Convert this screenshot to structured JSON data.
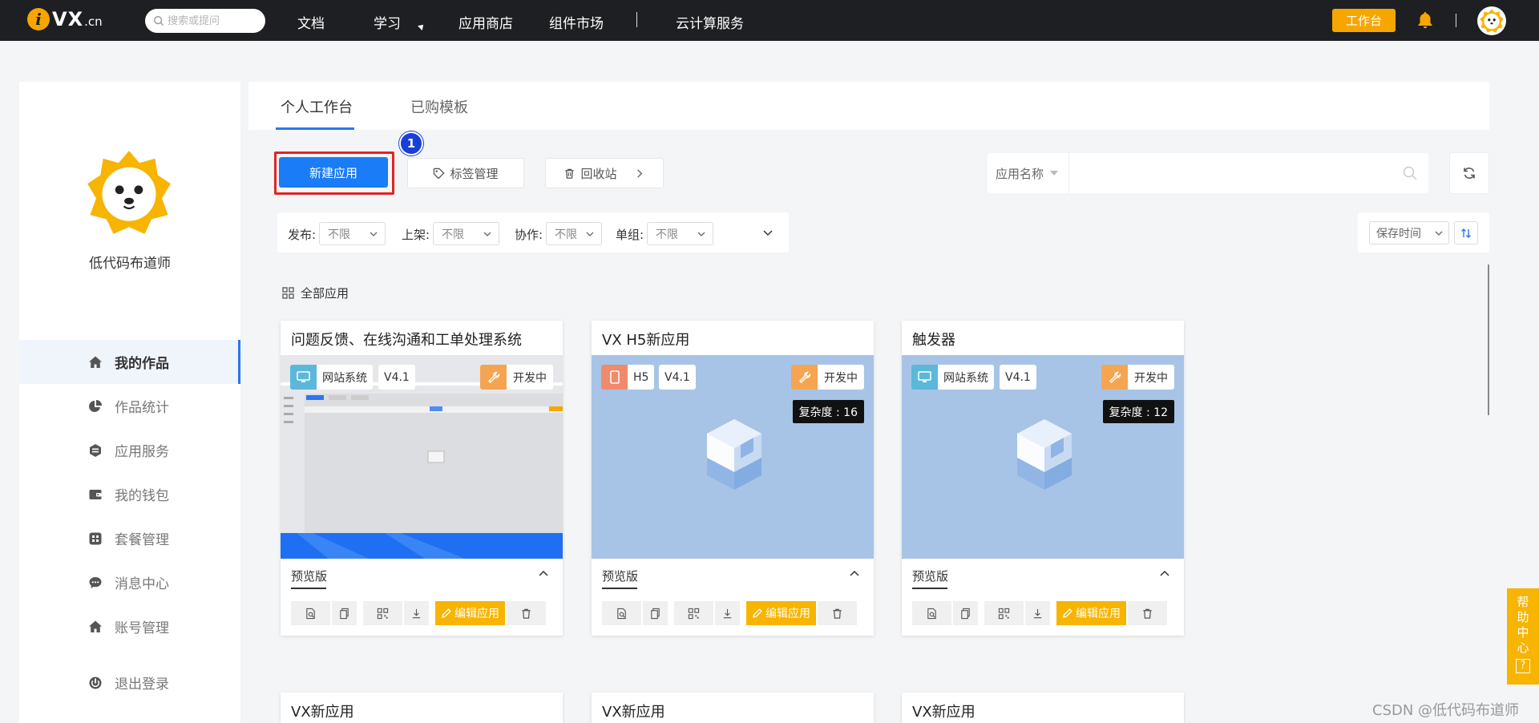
{
  "topbar": {
    "logo_text": "VX",
    "logo_suffix": ".cn",
    "search_placeholder": "搜索或提问",
    "nav": [
      "文档",
      "学习",
      "应用商店",
      "组件市场",
      "云计算服务"
    ],
    "workbench_label": "工作台"
  },
  "sidebar": {
    "username": "低代码布道师",
    "menu": [
      {
        "label": "我的作品",
        "icon": "home-icon"
      },
      {
        "label": "作品统计",
        "icon": "pie-chart-icon"
      },
      {
        "label": "应用服务",
        "icon": "service-icon"
      },
      {
        "label": "我的钱包",
        "icon": "wallet-icon"
      },
      {
        "label": "套餐管理",
        "icon": "grid-icon"
      },
      {
        "label": "消息中心",
        "icon": "chat-icon"
      },
      {
        "label": "账号管理",
        "icon": "home-icon"
      },
      {
        "label": "退出登录",
        "icon": "power-icon"
      }
    ]
  },
  "tabs": [
    "个人工作台",
    "已购模板"
  ],
  "toolbar": {
    "new_app": "新建应用",
    "step_badge": "1",
    "tag_manage": "标签管理",
    "recycle": "回收站",
    "search_select": "应用名称",
    "search_placeholder": ""
  },
  "filters": [
    {
      "label": "发布:",
      "value": "不限"
    },
    {
      "label": "上架:",
      "value": "不限"
    },
    {
      "label": "协作:",
      "value": "不限"
    },
    {
      "label": "单组:",
      "value": "不限"
    }
  ],
  "sort": {
    "value": "保存时间"
  },
  "section_title": "全部应用",
  "cards": [
    {
      "title": "问题反馈、在线沟通和工单处理系统",
      "type": "网站系统",
      "version": "V4.1",
      "status": "开发中",
      "complexity": "",
      "preview_tab": "预览版",
      "edit_label": "编辑应用"
    },
    {
      "title": "VX H5新应用",
      "type": "H5",
      "version": "V4.1",
      "status": "开发中",
      "complexity": "复杂度 : 16",
      "preview_tab": "预览版",
      "edit_label": "编辑应用"
    },
    {
      "title": "触发器",
      "type": "网站系统",
      "version": "V4.1",
      "status": "开发中",
      "complexity": "复杂度 : 12",
      "preview_tab": "预览版",
      "edit_label": "编辑应用"
    }
  ],
  "cards_row2": [
    "VX新应用",
    "VX新应用",
    "VX新应用"
  ],
  "help_label": [
    "帮",
    "助",
    "中",
    "心"
  ],
  "watermark": "CSDN @低代码布道师",
  "colors": {
    "accent": "#1a7cf6",
    "brand": "#f7a600",
    "edit": "#f7b400"
  }
}
